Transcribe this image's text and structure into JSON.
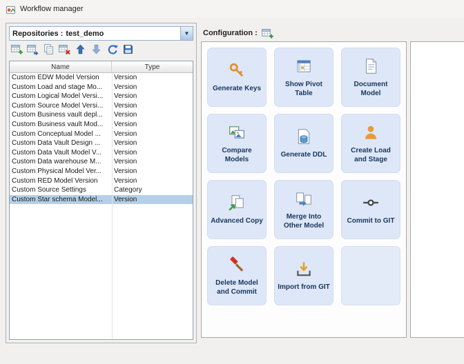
{
  "window": {
    "title": "Workflow manager"
  },
  "left_panel": {
    "repositories_label": "Repositories :",
    "repository_value": "test_demo",
    "combo_arrow": "▼",
    "toolbar_icons": [
      "new-table-icon",
      "duplicate-table-icon",
      "copy-icon",
      "delete-table-icon",
      "move-up-icon",
      "move-down-icon",
      "refresh-icon",
      "save-icon"
    ],
    "table": {
      "columns": [
        "Name",
        "Type"
      ],
      "rows": [
        [
          "Custom EDW Model Version",
          "Version"
        ],
        [
          "Custom Load and stage Mo...",
          "Version"
        ],
        [
          "Custom Logical Model Versi...",
          "Version"
        ],
        [
          "Custom Source Model Versi...",
          "Version"
        ],
        [
          "Custom Business vault depl...",
          "Version"
        ],
        [
          "Custom Business vault Mod...",
          "Version"
        ],
        [
          "Custom Conceptual Model ...",
          "Version"
        ],
        [
          "Custom Data Vault Design ...",
          "Version"
        ],
        [
          "Custom Data Vault Model V...",
          "Version"
        ],
        [
          "Custom Data warehouse M...",
          "Version"
        ],
        [
          "Custom Physical Model Ver...",
          "Version"
        ],
        [
          "Custom RED Model Version",
          "Version"
        ],
        [
          "Custom Source Settings",
          "Category"
        ],
        [
          "Custom Star schema Model...",
          "Version"
        ]
      ],
      "selected_row_index": 13
    }
  },
  "right_panel": {
    "configuration_label": "Configuration :",
    "configuration_icon": "add-config-icon",
    "tiles": [
      {
        "label": "Generate Keys",
        "icon": "key-icon"
      },
      {
        "label": "Show Pivot Table",
        "icon": "pivot-table-icon"
      },
      {
        "label": "Document Model",
        "icon": "document-icon"
      },
      {
        "label": "Compare Models",
        "icon": "compare-icon"
      },
      {
        "label": "Generate DDL",
        "icon": "database-document-icon"
      },
      {
        "label": "Create Load and Stage",
        "icon": "load-stage-icon"
      },
      {
        "label": "Advanced Copy",
        "icon": "advanced-copy-icon"
      },
      {
        "label": "Merge Into Other Model",
        "icon": "merge-icon"
      },
      {
        "label": "Commit to GIT",
        "icon": "commit-git-icon"
      },
      {
        "label": "Delete Model and Commit",
        "icon": "delete-commit-icon"
      },
      {
        "label": "Import from GIT",
        "icon": "import-git-icon"
      },
      {
        "label": "",
        "icon": ""
      }
    ]
  }
}
